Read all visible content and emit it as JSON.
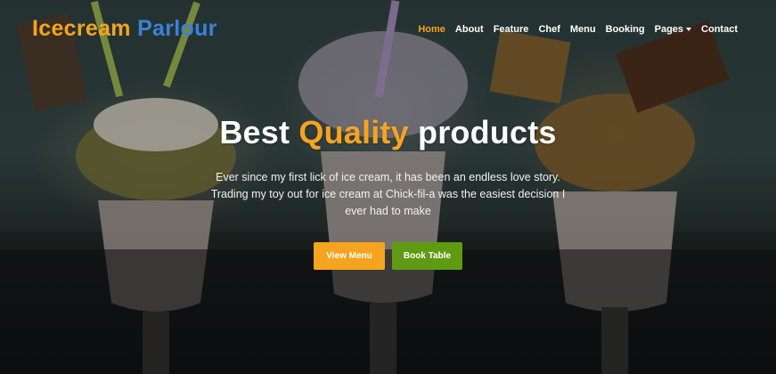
{
  "brand": {
    "part1": "Icecream",
    "part2": "Parlour"
  },
  "nav": {
    "items": [
      {
        "label": "Home",
        "active": true
      },
      {
        "label": "About"
      },
      {
        "label": "Feature"
      },
      {
        "label": "Chef"
      },
      {
        "label": "Menu"
      },
      {
        "label": "Booking"
      },
      {
        "label": "Pages",
        "dropdown": true
      },
      {
        "label": "Contact"
      }
    ]
  },
  "hero": {
    "title_part1": "Best",
    "title_highlight": "Quality",
    "title_part2": "products",
    "description": "Ever since my first lick of ice cream, it has been an endless love story. Trading my toy out for ice cream at Chick-fil-a was the easiest decision I ever had to make",
    "primary_button": "View Menu",
    "secondary_button": "Book Table"
  },
  "colors": {
    "accent": "#f5a41f",
    "brand_blue": "#3b82d6",
    "secondary_button": "#5f9a13"
  }
}
